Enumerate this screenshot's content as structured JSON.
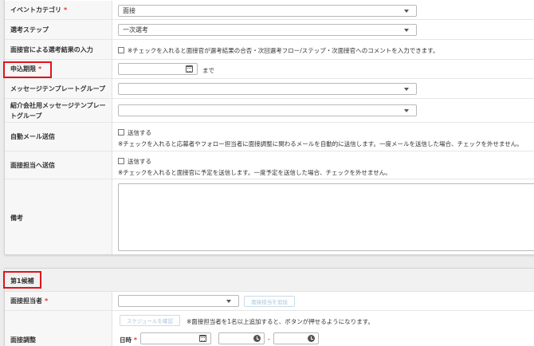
{
  "form": {
    "event_category": {
      "label": "イベントカテゴリ",
      "required": "*",
      "value": "面接"
    },
    "selection_step": {
      "label": "選考ステップ",
      "value": "一次選考"
    },
    "interviewer_input": {
      "label": "面接官による選考結果の入力",
      "checkbox_text": "※チェックを入れると面接官が選考結果の合否・次回選考フロー/ステップ・次面接官へのコメントを入力できます。"
    },
    "deadline": {
      "label": "申込期限",
      "required": "*",
      "suffix": "まで"
    },
    "message_template_group": {
      "label": "メッセージテンプレートグループ",
      "value": ""
    },
    "referral_template_group": {
      "label": "紹介会社用メッセージテンプレートグループ",
      "value": ""
    },
    "auto_mail": {
      "label": "自動メール送信",
      "checkbox_label": "送信する",
      "note": "※チェックを入れると応募者やフォロー担当者に面接調整に関わるメールを自動的に送信します。一度メールを送信した場合、チェックを外せません。"
    },
    "send_to_interviewer": {
      "label": "面接担当へ送信",
      "checkbox_label": "送信する",
      "note": "※チェックを入れると面接官に予定を送信します。一度予定を送信した場合、チェックを外せません。"
    },
    "remarks": {
      "label": "備考",
      "value": ""
    }
  },
  "candidate1": {
    "title": "第1候補",
    "interviewer": {
      "label": "面接担当者",
      "required": "*",
      "value": "",
      "add_button": "面接担当を追加"
    },
    "adjustment": {
      "label": "面接調整",
      "schedule_button": "スケジュールを確認",
      "note": "※面接担当者を1名以上追加すると、ボタンが押せるようになります。",
      "datetime_label": "日時",
      "required": "*",
      "dash": "-"
    }
  },
  "colors": {
    "required": "#e0312b",
    "highlight": "#e1141b",
    "label_bg": "#f7f7f7",
    "disabled_button_text": "#a9c4da"
  },
  "icons": [
    "chevron-down-icon",
    "calendar-icon",
    "clock-icon",
    "checkbox-icon"
  ]
}
